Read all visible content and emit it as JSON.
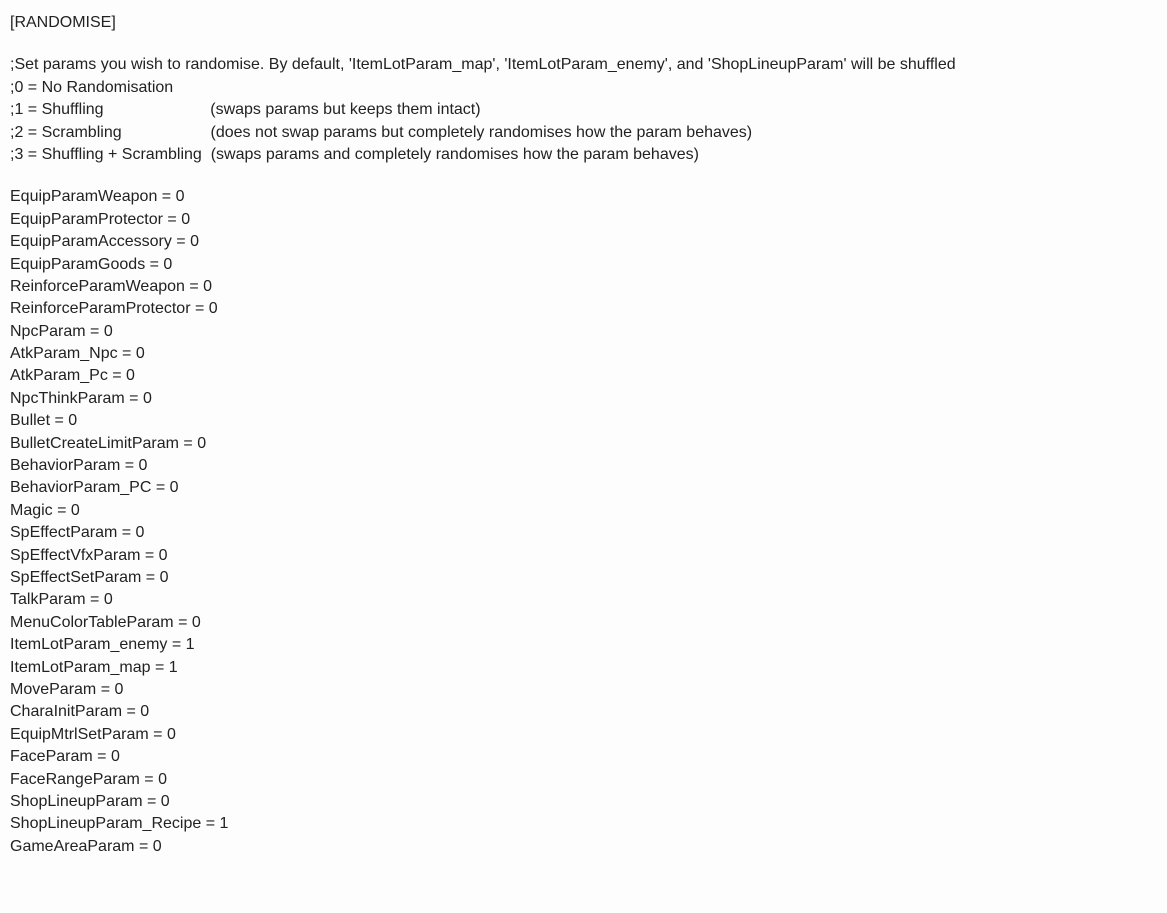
{
  "header": "[RANDOMISE]",
  "comments": [
    ";Set params you wish to randomise. By default, 'ItemLotParam_map', 'ItemLotParam_enemy', and 'ShopLineupParam' will be shuffled",
    ";0 = No Randomisation",
    ";1 = Shuffling                        (swaps params but keeps them intact)",
    ";2 = Scrambling                    (does not swap params but completely randomises how the param behaves)",
    ";3 = Shuffling + Scrambling  (swaps params and completely randomises how the param behaves)"
  ],
  "params": [
    {
      "key": "EquipParamWeapon",
      "value": "0"
    },
    {
      "key": "EquipParamProtector",
      "value": "0"
    },
    {
      "key": "EquipParamAccessory",
      "value": "0"
    },
    {
      "key": "EquipParamGoods",
      "value": "0"
    },
    {
      "key": "ReinforceParamWeapon",
      "value": "0"
    },
    {
      "key": "ReinforceParamProtector",
      "value": "0"
    },
    {
      "key": "NpcParam",
      "value": "0"
    },
    {
      "key": "AtkParam_Npc",
      "value": "0"
    },
    {
      "key": "AtkParam_Pc",
      "value": "0"
    },
    {
      "key": "NpcThinkParam",
      "value": "0"
    },
    {
      "key": "Bullet",
      "value": "0"
    },
    {
      "key": "BulletCreateLimitParam",
      "value": "0"
    },
    {
      "key": "BehaviorParam",
      "value": "0"
    },
    {
      "key": "BehaviorParam_PC",
      "value": "0"
    },
    {
      "key": "Magic",
      "value": "0"
    },
    {
      "key": "SpEffectParam",
      "value": "0"
    },
    {
      "key": "SpEffectVfxParam",
      "value": "0"
    },
    {
      "key": "SpEffectSetParam",
      "value": "0"
    },
    {
      "key": "TalkParam",
      "value": "0"
    },
    {
      "key": "MenuColorTableParam",
      "value": "0"
    },
    {
      "key": "ItemLotParam_enemy",
      "value": "1"
    },
    {
      "key": "ItemLotParam_map",
      "value": "1"
    },
    {
      "key": "MoveParam",
      "value": "0"
    },
    {
      "key": "CharaInitParam",
      "value": "0"
    },
    {
      "key": "EquipMtrlSetParam",
      "value": "0"
    },
    {
      "key": "FaceParam",
      "value": "0"
    },
    {
      "key": "FaceRangeParam",
      "value": "0"
    },
    {
      "key": "ShopLineupParam",
      "value": "0"
    },
    {
      "key": "ShopLineupParam_Recipe",
      "value": "1"
    },
    {
      "key": "GameAreaParam",
      "value": "0"
    }
  ]
}
